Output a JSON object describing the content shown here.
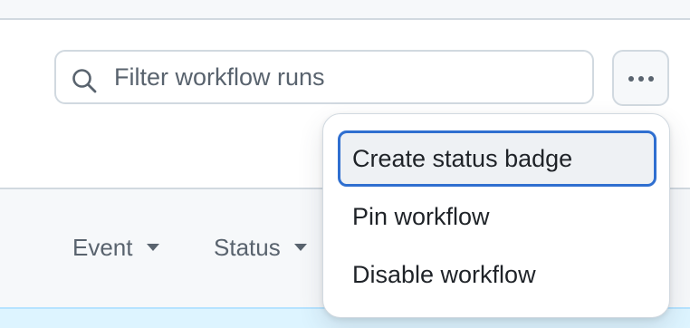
{
  "search": {
    "placeholder": "Filter workflow runs",
    "icon": "search-icon"
  },
  "more_actions": {
    "icon": "kebab-horizontal-icon"
  },
  "filters": [
    {
      "label": "Event",
      "icon": "triangle-down-icon"
    },
    {
      "label": "Status",
      "icon": "triangle-down-icon"
    }
  ],
  "menu": {
    "items": [
      {
        "label": "Create status badge",
        "focused": true
      },
      {
        "label": "Pin workflow"
      },
      {
        "label": "Disable workflow"
      }
    ]
  },
  "colors": {
    "focus_ring": "#2f6fd0",
    "border": "#d1d9e0",
    "muted_text": "#59636e",
    "canvas_subtle": "#f6f8fa",
    "selected_row": "#ddf4ff"
  }
}
